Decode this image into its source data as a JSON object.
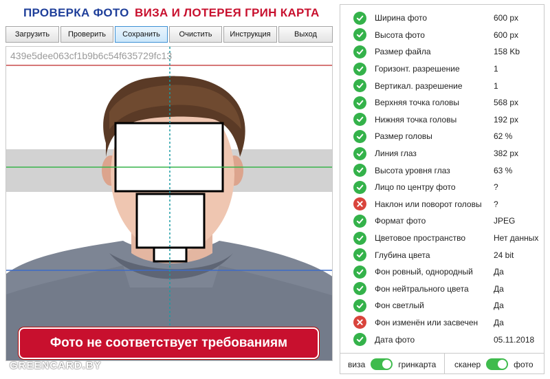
{
  "header": {
    "title": "ПРОВЕРКА ФОТО",
    "subtitle": "ВИЗА И ЛОТЕРЕЯ ГРИН КАРТА"
  },
  "toolbar": {
    "buttons": [
      {
        "label": "Загрузить",
        "active": false
      },
      {
        "label": "Проверить",
        "active": false
      },
      {
        "label": "Сохранить",
        "active": true
      },
      {
        "label": "Очистить",
        "active": false
      },
      {
        "label": "Инструкция",
        "active": false
      },
      {
        "label": "Выход",
        "active": false
      }
    ]
  },
  "photo": {
    "hash": "439e5dee063cf1b9b6c54f635729fc13",
    "alert": "Фото не соответствует требованиям",
    "watermark": "GREENCARD.BY"
  },
  "checks": [
    {
      "label": "Ширина фото",
      "value": "600 px",
      "status": "ok"
    },
    {
      "label": "Высота фото",
      "value": "600 px",
      "status": "ok"
    },
    {
      "label": "Размер файла",
      "value": "158 Kb",
      "status": "ok"
    },
    {
      "label": "Горизонт. разрешение",
      "value": "1",
      "status": "ok"
    },
    {
      "label": "Вертикал. разрешение",
      "value": "1",
      "status": "ok"
    },
    {
      "label": "Верхняя точка головы",
      "value": "568 px",
      "status": "ok"
    },
    {
      "label": "Нижняя точка головы",
      "value": "192 px",
      "status": "ok"
    },
    {
      "label": "Размер головы",
      "value": "62 %",
      "status": "ok"
    },
    {
      "label": "Линия глаз",
      "value": "382 px",
      "status": "ok"
    },
    {
      "label": "Высота уровня глаз",
      "value": "63 %",
      "status": "ok"
    },
    {
      "label": "Лицо по центру фото",
      "value": "?",
      "status": "ok"
    },
    {
      "label": "Наклон или поворот головы",
      "value": "?",
      "status": "error"
    },
    {
      "label": "Формат фото",
      "value": "JPEG",
      "status": "ok"
    },
    {
      "label": "Цветовое пространство",
      "value": "Нет данных",
      "status": "ok"
    },
    {
      "label": "Глубина цвета",
      "value": "24 bit",
      "status": "ok"
    },
    {
      "label": "Фон ровный, однородный",
      "value": "Да",
      "status": "ok"
    },
    {
      "label": "Фон нейтрального цвета",
      "value": "Да",
      "status": "ok"
    },
    {
      "label": "Фон светлый",
      "value": "Да",
      "status": "ok"
    },
    {
      "label": "Фон изменён или засвечен",
      "value": "Да",
      "status": "error"
    },
    {
      "label": "Дата фото",
      "value": "05.11.2018",
      "status": "ok"
    }
  ],
  "footer": {
    "toggle1": {
      "left": "виза",
      "right": "гринкарта",
      "on": true
    },
    "toggle2": {
      "left": "сканер",
      "right": "фото",
      "on": true
    }
  },
  "colors": {
    "title": "#1f3f9a",
    "subtitle": "#c8102e",
    "ok": "#34b24a",
    "error": "#d9443c",
    "alert_bg": "#c8102e",
    "toggle": "#3fbb4d"
  },
  "icons": {
    "ok": "check-circle-icon",
    "error": "x-circle-icon"
  }
}
